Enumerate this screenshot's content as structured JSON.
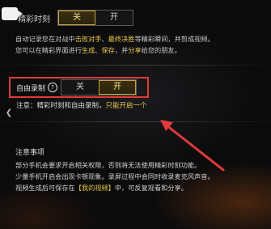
{
  "highlight_row": {
    "label": "精彩时刻",
    "options": [
      "关",
      "开"
    ],
    "selected": "关"
  },
  "highlight_desc": {
    "line1_prefix": "自动记录您在对战中",
    "line1_h1": "击败对手",
    "line1_sep": "、",
    "line1_h2": "最终决胜",
    "line1_suffix": "等精彩瞬间，并剪成视频。",
    "line2_prefix": "您可以在精彩界面进行",
    "line2_h1": "生成",
    "line2_sep1": "、",
    "line2_h2": "保存",
    "line2_sep2": "，并",
    "line2_h3": "分享",
    "line2_suffix": "给您的朋友。"
  },
  "record_row": {
    "label": "自由录制",
    "help_icon": "question-circle-icon",
    "options": [
      "关",
      "开"
    ],
    "selected": "开"
  },
  "record_note": {
    "prefix": "注意：精彩时刻和自由录制，",
    "highlight": "只能开启一个"
  },
  "notes": {
    "title": "注意事项",
    "line1": "部分手机会要求开启相关权限，否则将无法使用精彩时刻功能。",
    "line2": "少量手机开启会出现卡顿现象。录屏过程中会同时收录麦克风声音。",
    "line3_prefix": "视频生成后可保存在",
    "line3_highlight": "【我的视频】",
    "line3_suffix": "中，可反复观看和分享。"
  },
  "colors": {
    "accent_gold": "#e9c84a",
    "annotation_red": "#e23a3a"
  }
}
